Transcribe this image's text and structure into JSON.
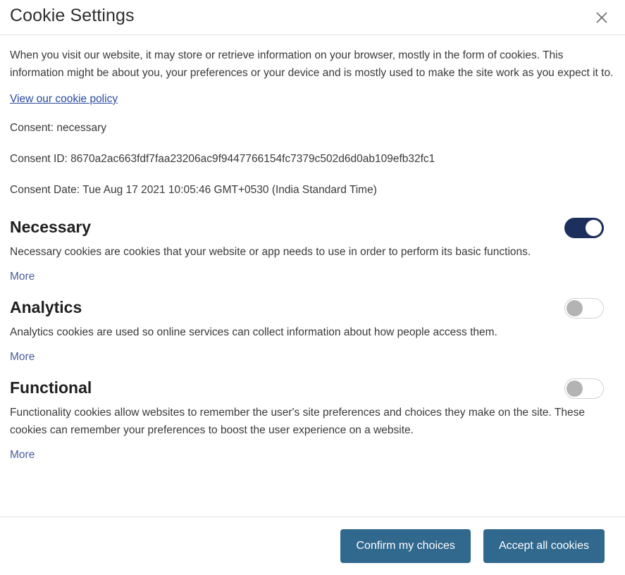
{
  "dialog": {
    "title": "Cookie Settings",
    "close_icon": "close-icon",
    "intro": "When you visit our website, it may store or retrieve information on your browser, mostly in the form of cookies. This information might be about you, your preferences or your device and is mostly used to make the site work as you expect it to.",
    "policy_link": "View our cookie policy",
    "consent_label": "Consent: necessary",
    "consent_id": "Consent ID: 8670a2ac663fdf7faa23206ac9f9447766154fc7379c502d6d0ab109efb32fc1",
    "consent_date": "Consent Date: Tue Aug 17 2021 10:05:46 GMT+0530 (India Standard Time)"
  },
  "categories": [
    {
      "title": "Necessary",
      "description": "Necessary cookies are cookies that your website or app needs to use in order to perform its basic functions.",
      "more_label": "More",
      "enabled": true,
      "toggle_state": "on"
    },
    {
      "title": "Analytics",
      "description": "Analytics cookies are used so online services can collect information about how people access them.",
      "more_label": "More",
      "enabled": false,
      "toggle_state": "off"
    },
    {
      "title": "Functional",
      "description": "Functionality cookies allow websites to remember the user's site preferences and choices they make on the site. These cookies can remember your preferences to boost the user experience on a website.",
      "more_label": "More",
      "enabled": false,
      "toggle_state": "off"
    }
  ],
  "footer": {
    "confirm_label": "Confirm my choices",
    "accept_all_label": "Accept all cookies"
  },
  "colors": {
    "toggle_on": "#1d2f5c",
    "toggle_off_knob": "#b3b3b3",
    "button_blue": "#31688e",
    "link_blue": "#2b4ba0",
    "more_link_blue": "#4a5d9b"
  }
}
